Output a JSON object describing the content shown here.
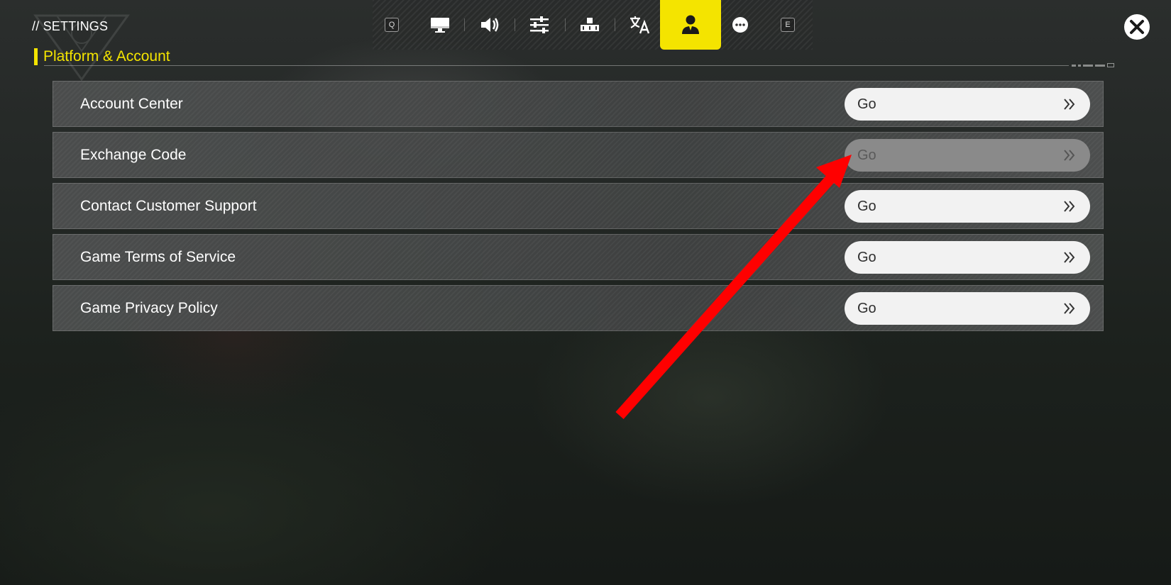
{
  "header": {
    "title": "// SETTINGS",
    "section_title": "Platform & Account"
  },
  "tabs": {
    "left_key": "Q",
    "right_key": "E",
    "items": [
      {
        "icon": "monitor-icon",
        "active": false
      },
      {
        "icon": "speaker-icon",
        "active": false
      },
      {
        "icon": "sliders-icon",
        "active": false
      },
      {
        "icon": "keyboard-icon",
        "active": false
      },
      {
        "icon": "language-icon",
        "active": false
      },
      {
        "icon": "account-icon",
        "active": true
      },
      {
        "icon": "more-icon",
        "active": false
      }
    ]
  },
  "rows": [
    {
      "label": "Account Center",
      "button": "Go",
      "disabled": false
    },
    {
      "label": "Exchange Code",
      "button": "Go",
      "disabled": true
    },
    {
      "label": "Contact Customer Support",
      "button": "Go",
      "disabled": false
    },
    {
      "label": "Game Terms of Service",
      "button": "Go",
      "disabled": false
    },
    {
      "label": "Game Privacy Policy",
      "button": "Go",
      "disabled": false
    }
  ],
  "colors": {
    "accent": "#f4e400",
    "row_bg": "#4a4c4c",
    "button_bg": "#f2f2f2",
    "button_disabled_bg": "#8a8a8a",
    "annotation_arrow": "#ff0000"
  }
}
